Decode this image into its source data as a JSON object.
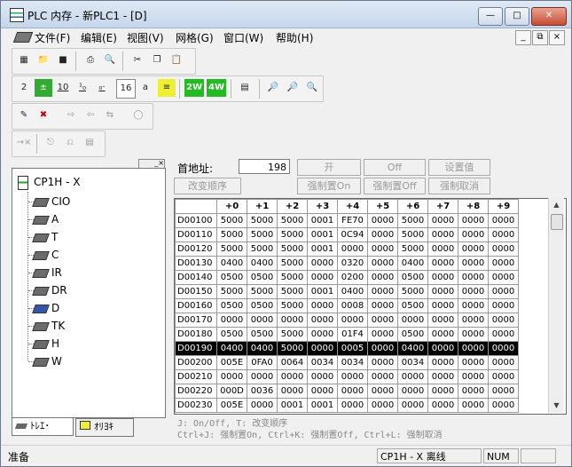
{
  "window": {
    "title": "PLC 内存 - 新PLC1 - [D]"
  },
  "menu": [
    "文件(F)",
    "编辑(E)",
    "视图(V)",
    "网格(G)",
    "窗口(W)",
    "帮助(H)"
  ],
  "toolbar2": {
    "b10": "10",
    "b16": "16",
    "ba": "a",
    "b2w": "2W",
    "b4w": "4W"
  },
  "tree": {
    "root": "CP1H - X",
    "items": [
      "CIO",
      "A",
      "T",
      "C",
      "IR",
      "DR",
      "D",
      "TK",
      "H",
      "W"
    ]
  },
  "tabs": [
    "ﾄﾚｴ･",
    "ｵﾘﾖｷ"
  ],
  "form": {
    "start_label": "首地址:",
    "start_value": "198",
    "btn_on": "开",
    "btn_off": "Off",
    "btn_setval": "设置值",
    "btn_change_order": "改变顺序",
    "btn_force_on": "强制置On",
    "btn_force_off": "强制置Off",
    "btn_force_cancel": "强制取消"
  },
  "grid": {
    "columns": [
      "+0",
      "+1",
      "+2",
      "+3",
      "+4",
      "+5",
      "+6",
      "+7",
      "+8",
      "+9"
    ],
    "selected_row": 9,
    "rows": [
      {
        "addr": "D00100",
        "vals": [
          "5000",
          "5000",
          "5000",
          "0001",
          "FE70",
          "0000",
          "5000",
          "0000",
          "0000",
          "0000"
        ]
      },
      {
        "addr": "D00110",
        "vals": [
          "5000",
          "5000",
          "5000",
          "0001",
          "0C94",
          "0000",
          "5000",
          "0000",
          "0000",
          "0000"
        ]
      },
      {
        "addr": "D00120",
        "vals": [
          "5000",
          "5000",
          "5000",
          "0001",
          "0000",
          "0000",
          "5000",
          "0000",
          "0000",
          "0000"
        ]
      },
      {
        "addr": "D00130",
        "vals": [
          "0400",
          "0400",
          "5000",
          "0000",
          "0320",
          "0000",
          "0400",
          "0000",
          "0000",
          "0000"
        ]
      },
      {
        "addr": "D00140",
        "vals": [
          "0500",
          "0500",
          "5000",
          "0000",
          "0200",
          "0000",
          "0500",
          "0000",
          "0000",
          "0000"
        ]
      },
      {
        "addr": "D00150",
        "vals": [
          "5000",
          "5000",
          "5000",
          "0001",
          "0400",
          "0000",
          "5000",
          "0000",
          "0000",
          "0000"
        ]
      },
      {
        "addr": "D00160",
        "vals": [
          "0500",
          "0500",
          "5000",
          "0000",
          "0008",
          "0000",
          "0500",
          "0000",
          "0000",
          "0000"
        ]
      },
      {
        "addr": "D00170",
        "vals": [
          "0000",
          "0000",
          "0000",
          "0000",
          "0000",
          "0000",
          "0000",
          "0000",
          "0000",
          "0000"
        ]
      },
      {
        "addr": "D00180",
        "vals": [
          "0500",
          "0500",
          "5000",
          "0000",
          "01F4",
          "0000",
          "0500",
          "0000",
          "0000",
          "0000"
        ]
      },
      {
        "addr": "D00190",
        "vals": [
          "0400",
          "0400",
          "5000",
          "0000",
          "0005",
          "0000",
          "0400",
          "0000",
          "0000",
          "0000"
        ]
      },
      {
        "addr": "D00200",
        "vals": [
          "005E",
          "0FA0",
          "0064",
          "0034",
          "0034",
          "0000",
          "0034",
          "0000",
          "0000",
          "0000"
        ]
      },
      {
        "addr": "D00210",
        "vals": [
          "0000",
          "0000",
          "0000",
          "0000",
          "0000",
          "0000",
          "0000",
          "0000",
          "0000",
          "0000"
        ]
      },
      {
        "addr": "D00220",
        "vals": [
          "000D",
          "0036",
          "0000",
          "0000",
          "0000",
          "0000",
          "0000",
          "0000",
          "0000",
          "0000"
        ]
      },
      {
        "addr": "D00230",
        "vals": [
          "005E",
          "0000",
          "0001",
          "0001",
          "0000",
          "0000",
          "0000",
          "0000",
          "0000",
          "0000"
        ]
      }
    ]
  },
  "help": {
    "line1": "J: On/Off,   T: 改变顺序",
    "line2": "Ctrl+J: 强制置On,  Ctrl+K:  强制置Off,  Ctrl+L: 强制取消"
  },
  "status": {
    "left": "准备",
    "plc": "CP1H - X 离线",
    "num": "NUM"
  }
}
